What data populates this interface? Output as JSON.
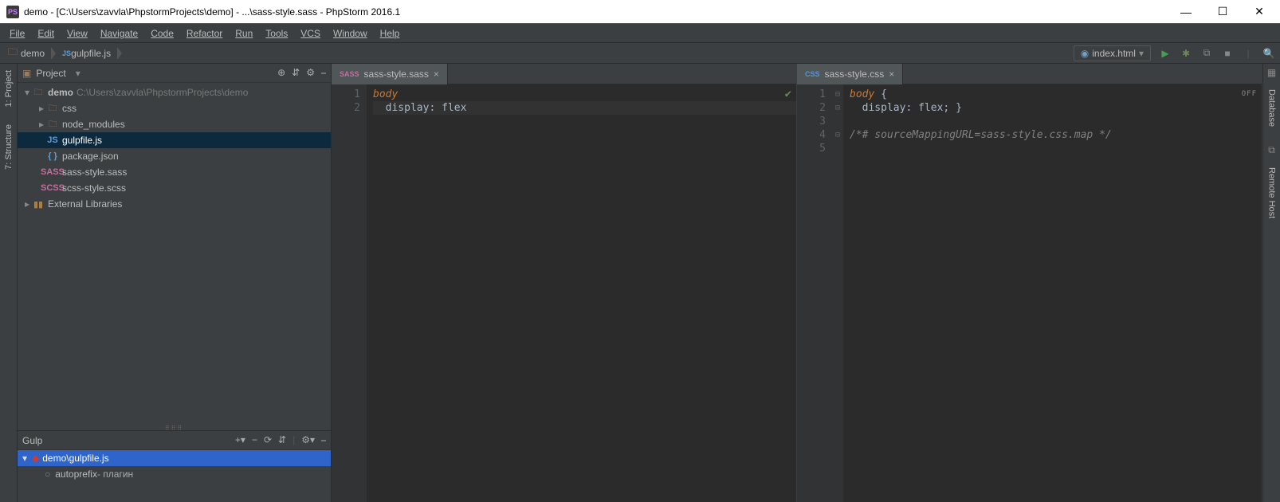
{
  "window": {
    "title": "demo - [C:\\Users\\zavvla\\PhpstormProjects\\demo] - ...\\sass-style.sass - PhpStorm 2016.1",
    "app_icon_text": "PS"
  },
  "menu": {
    "file": "File",
    "edit": "Edit",
    "view": "View",
    "navigate": "Navigate",
    "code": "Code",
    "refactor": "Refactor",
    "run": "Run",
    "tools": "Tools",
    "vcs": "VCS",
    "window": "Window",
    "help": "Help"
  },
  "breadcrumb": {
    "items": [
      "demo",
      "gulpfile.js"
    ]
  },
  "run_config": {
    "label": "index.html"
  },
  "left_tools": {
    "project": "1: Project",
    "structure": "7: Structure"
  },
  "right_tools": {
    "database": "Database",
    "remote_host": "Remote Host"
  },
  "project_panel": {
    "title": "Project",
    "root": {
      "name": "demo",
      "path": "C:\\Users\\zavvla\\PhpstormProjects\\demo"
    },
    "folders": [
      "css",
      "node_modules"
    ],
    "files": [
      "gulpfile.js",
      "package.json",
      "sass-style.sass",
      "scss-style.scss"
    ],
    "external": "External Libraries"
  },
  "gulp_panel": {
    "title": "Gulp",
    "file": "demo\\gulpfile.js",
    "task": "autoprefix",
    "task_note": " - плагин"
  },
  "editor_left": {
    "tab": "sass-style.sass",
    "lines": {
      "1": "body",
      "2_prop": "display",
      "2_val": "flex"
    }
  },
  "editor_right": {
    "tab": "sass-style.css",
    "off": "OFF",
    "l1_sel": "body",
    "l2_prop": "display",
    "l2_val": "flex",
    "comment": "/*# sourceMappingURL=sass-style.css.map */"
  }
}
